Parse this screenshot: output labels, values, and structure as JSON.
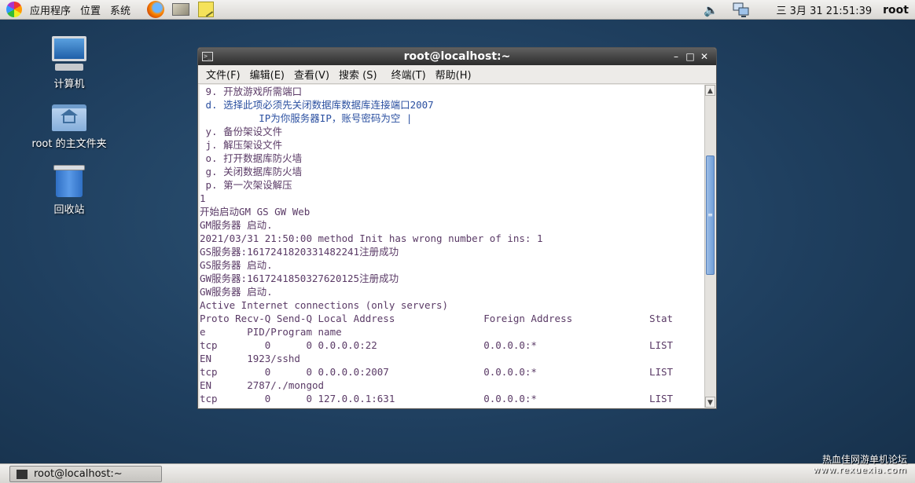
{
  "top_panel": {
    "menus": [
      "应用程序",
      "位置",
      "系统"
    ],
    "launchers": [
      "firefox-icon",
      "mail-icon",
      "notes-icon"
    ],
    "clock": "三 3月 31 21:51:39",
    "user": "root"
  },
  "desktop": {
    "icons": [
      {
        "label": "计算机",
        "icon": "computer-icon"
      },
      {
        "label": "root 的主文件夹",
        "icon": "home-folder-icon"
      },
      {
        "label": "回收站",
        "icon": "trash-icon"
      }
    ]
  },
  "terminal": {
    "title": "root@localhost:~",
    "menu": [
      "文件(F)",
      "编辑(E)",
      "查看(V)",
      "搜索 (S)",
      "终端(T)",
      "帮助(H)"
    ],
    "lines": [
      {
        "text": " 9. 开放游戏所需端口",
        "color": "purple"
      },
      {
        "text": " d. 选择此项必须先关闭数据库数据库连接端口2007",
        "color": "blue"
      },
      {
        "text": "          IP为你服务器IP，账号密码为空 |",
        "color": "blue"
      },
      {
        "text": " y. 备份架设文件",
        "color": "purple"
      },
      {
        "text": " j. 解压架设文件",
        "color": "purple"
      },
      {
        "text": " o. 打开数据库防火墙",
        "color": "purple"
      },
      {
        "text": " g. 关闭数据库防火墙",
        "color": "purple"
      },
      {
        "text": " p. 第一次架设解压",
        "color": "purple"
      },
      {
        "text": "1",
        "color": "purple"
      },
      {
        "text": "开始启动GM GS GW Web",
        "color": "purple"
      },
      {
        "text": "GM服务器 启动.",
        "color": "purple"
      },
      {
        "text": "2021/03/31 21:50:00 method Init has wrong number of ins: 1",
        "color": "purple"
      },
      {
        "text": "GS服务器:1617241820331482241注册成功",
        "color": "purple"
      },
      {
        "text": "GS服务器 启动.",
        "color": "purple"
      },
      {
        "text": "GW服务器:1617241850327620125注册成功",
        "color": "purple"
      },
      {
        "text": "GW服务器 启动.",
        "color": "purple"
      },
      {
        "text": "Active Internet connections (only servers)",
        "color": "purple"
      },
      {
        "text": "Proto Recv-Q Send-Q Local Address               Foreign Address             Stat",
        "color": "purple"
      },
      {
        "text": "e       PID/Program name",
        "color": "purple"
      },
      {
        "text": "tcp        0      0 0.0.0.0:22                  0.0.0.0:*                   LIST",
        "color": "purple"
      },
      {
        "text": "EN      1923/sshd",
        "color": "purple"
      },
      {
        "text": "tcp        0      0 0.0.0.0:2007                0.0.0.0:*                   LIST",
        "color": "purple"
      },
      {
        "text": "EN      2787/./mongod",
        "color": "purple"
      },
      {
        "text": "tcp        0      0 127.0.0.1:631               0.0.0.0:*                   LIST",
        "color": "purple"
      }
    ]
  },
  "taskbar": {
    "task_label": "root@localhost:~"
  },
  "watermark": {
    "line1": "热血佳网游单机论坛",
    "line2": "www.rexuexia.com"
  }
}
